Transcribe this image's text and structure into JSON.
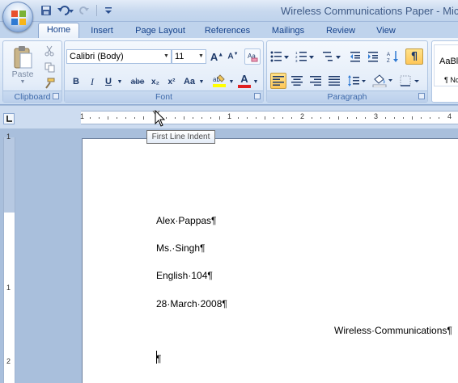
{
  "window": {
    "title": "Wireless Communications Paper - Micro"
  },
  "qat": {
    "icons": [
      "save-icon",
      "undo-icon",
      "redo-icon",
      "customize-qat-icon"
    ]
  },
  "tabs": [
    {
      "label": "Home",
      "active": true
    },
    {
      "label": "Insert"
    },
    {
      "label": "Page Layout"
    },
    {
      "label": "References"
    },
    {
      "label": "Mailings"
    },
    {
      "label": "Review"
    },
    {
      "label": "View"
    }
  ],
  "ribbon": {
    "clipboard": {
      "label": "Clipboard",
      "paste_label": "Paste"
    },
    "font": {
      "label": "Font",
      "font_name": "Calibri (Body)",
      "font_size": "11",
      "buttons": [
        "B",
        "I",
        "U",
        "abe",
        "x₂",
        "x²",
        "Aa"
      ]
    },
    "paragraph": {
      "label": "Paragraph"
    },
    "styles": {
      "preview_top": "AaBl",
      "preview_bottom": "¶ Nc"
    }
  },
  "ruler": {
    "numbers": [
      "1",
      "1",
      "2",
      "3",
      "4"
    ],
    "vertical_numbers": [
      "1",
      "1",
      "2"
    ]
  },
  "tooltip": {
    "text": "First Line Indent"
  },
  "document": {
    "lines": [
      "Alex·Pappas¶",
      "Ms.·Singh¶",
      "English·104¶",
      "28·March·2008¶"
    ],
    "centered_title": "Wireless·Communications¶",
    "empty_paragraph": "¶"
  },
  "colors": {
    "ribbon_accent": "#15428b",
    "window_bg": "#a9bfdc",
    "pressed_highlight": "#ffc758"
  }
}
